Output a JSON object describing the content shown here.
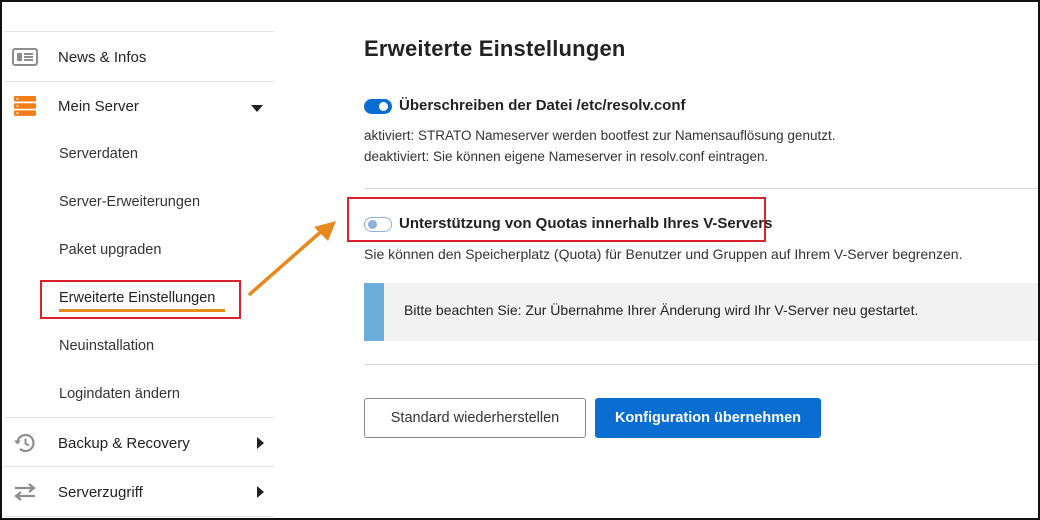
{
  "sidebar": {
    "news": {
      "label": "News & Infos",
      "icon": "newspaper-icon"
    },
    "server": {
      "label": "Mein Server",
      "icon": "server-stack-icon",
      "expanded": true
    },
    "subitems": [
      "Serverdaten",
      "Server-Erweiterungen",
      "Paket upgraden",
      "Erweiterte Einstellungen",
      "Neuinstallation",
      "Logindaten ändern"
    ],
    "active_item": "Erweiterte Einstellungen",
    "backup": {
      "label": "Backup & Recovery",
      "icon": "history-icon"
    },
    "access": {
      "label": "Serverzugriff",
      "icon": "swap-arrows-icon"
    }
  },
  "main": {
    "title": "Erweiterte Einstellungen",
    "option1": {
      "label": "Überschreiben der Datei /etc/resolv.conf",
      "enabled": true,
      "desc_line1": "aktiviert: STRATO Nameserver werden bootfest zur Namensauflösung genutzt.",
      "desc_line2": "deaktiviert: Sie können eigene Nameserver in resolv.conf eintragen."
    },
    "option2": {
      "label": "Unterstützung von Quotas innerhalb Ihres V-Servers",
      "enabled": false,
      "desc": "Sie können den Speicherplatz (Quota) für Benutzer und Gruppen auf Ihrem V-Server begrenzen."
    },
    "notice": "Bitte beachten Sie: Zur Übernahme Ihrer Änderung wird Ihr V-Server neu gestartet.",
    "buttons": {
      "reset": "Standard wiederherstellen",
      "apply": "Konfiguration übernehmen"
    }
  },
  "colors": {
    "accent": "#0a6ed1",
    "annotation_red": "#d9232c",
    "annotation_orange": "#e8891c",
    "notice_bar": "#6aaed9",
    "server_icon": "#f07d1a"
  }
}
